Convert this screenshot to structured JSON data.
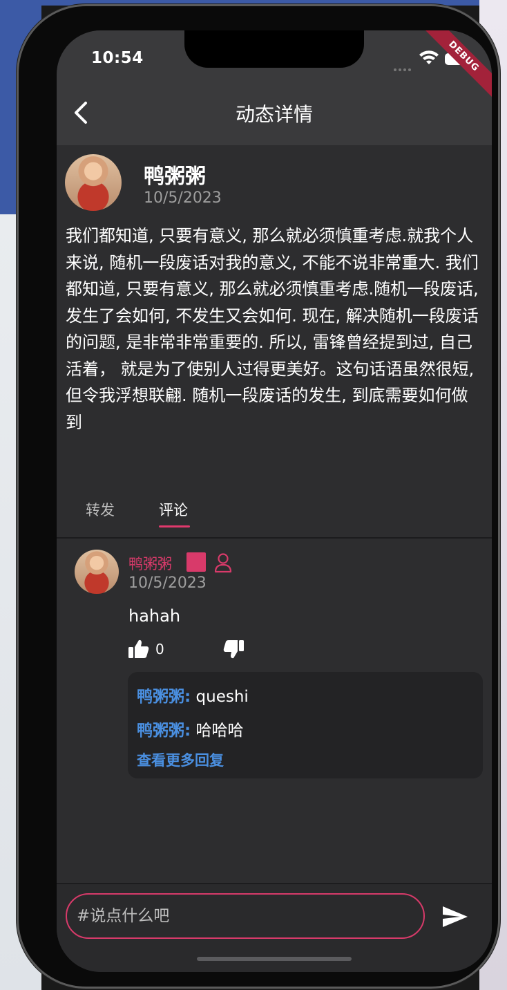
{
  "status_bar": {
    "time": "10:54",
    "debug_label": "DEBUG"
  },
  "header": {
    "title": "动态详情",
    "back_icon": "chevron-left-icon"
  },
  "post": {
    "author_name": "鸭粥粥",
    "date": "10/5/2023",
    "body": "我们都知道, 只要有意义, 那么就必须慎重考虑.就我个人来说, 随机一段废话对我的意义, 不能不说非常重大. 我们都知道, 只要有意义, 那么就必须慎重考虑.随机一段废话, 发生了会如何, 不发生又会如何. 现在, 解决随机一段废话的问题, 是非常非常重要的. 所以, 雷锋曾经提到过, 自己活着， 就是为了使别人过得更美好。这句话语虽然很短, 但令我浮想联翩. 随机一段废话的发生, 到底需要如何做到"
  },
  "tabs": [
    {
      "label": "转发",
      "active": false
    },
    {
      "label": "评论",
      "active": true
    }
  ],
  "comment": {
    "author_name": "鸭粥粥",
    "date": "10/5/2023",
    "text": "hahah",
    "like_count": "0",
    "replies": [
      {
        "name": "鸭粥粥:",
        "text": " queshi"
      },
      {
        "name": "鸭粥粥:",
        "text": " 哈哈哈"
      }
    ],
    "more_replies_label": "查看更多回复"
  },
  "input": {
    "placeholder": "#说点什么吧",
    "value": ""
  },
  "colors": {
    "accent": "#d83a6a",
    "link": "#4a8fe0",
    "background": "#2d2d2f",
    "header": "#3a3a3c"
  }
}
